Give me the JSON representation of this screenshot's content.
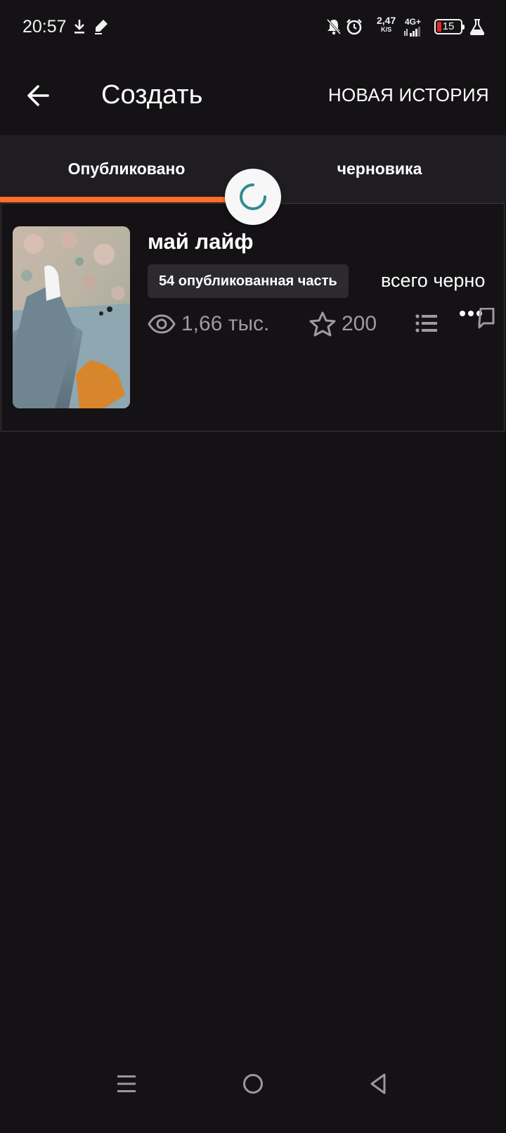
{
  "status_bar": {
    "time": "20:57",
    "net_speed_value": "2,47",
    "net_speed_unit": "K/S",
    "network_type": "4G+",
    "battery_level": "15",
    "icons": [
      "download-icon",
      "pen-icon",
      "bell-off-icon",
      "alarm-icon",
      "signal-icon",
      "battery-icon",
      "flask-icon"
    ]
  },
  "app_bar": {
    "title": "Создать",
    "new_story_label": "НОВАЯ ИСТОРИЯ"
  },
  "tabs": [
    {
      "label": "Опубликовано",
      "selected": true
    },
    {
      "label": "черновика",
      "selected": false
    }
  ],
  "colors": {
    "background": "#141215",
    "tab_indicator": "#ff6d2d",
    "spinner": "#2f8c8f",
    "muted_text": "#9d9ba0"
  },
  "story": {
    "title": "май лайф",
    "published_parts": "54 опубликованная часть",
    "drafts_total": "всего черно",
    "views": "1,66 тыс.",
    "votes": "200"
  },
  "nav_bar": {
    "icons": [
      "menu-icon",
      "home-circle-icon",
      "back-triangle-icon"
    ]
  }
}
